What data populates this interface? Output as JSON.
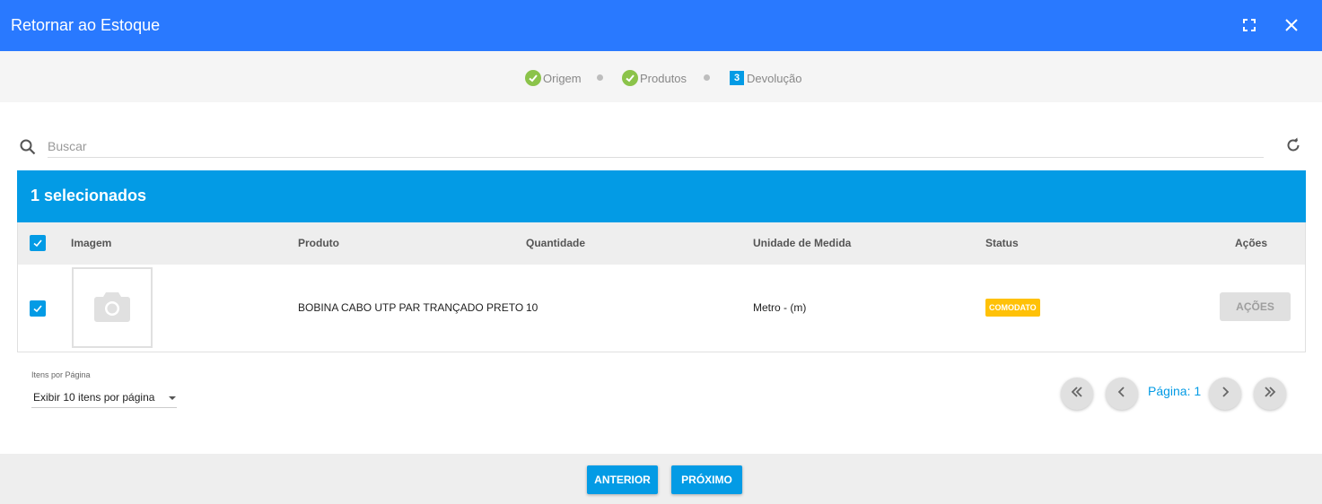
{
  "dialog": {
    "title": "Retornar ao Estoque"
  },
  "icons": {
    "fullscreen": "fullscreen-icon",
    "close": "close-icon",
    "search": "search-icon",
    "refresh": "refresh-icon",
    "camera": "camera-icon"
  },
  "stepper": {
    "steps": [
      {
        "label": "Origem",
        "state": "done"
      },
      {
        "label": "Produtos",
        "state": "done"
      },
      {
        "label": "Devolução",
        "state": "active",
        "number": "3"
      }
    ]
  },
  "search": {
    "placeholder": "Buscar",
    "value": ""
  },
  "selection": {
    "label": "1 selecionados"
  },
  "table": {
    "columns": [
      "Imagem",
      "Produto",
      "Quantidade",
      "Unidade de Medida",
      "Status",
      "Ações"
    ],
    "rows": [
      {
        "checked": true,
        "produto": "BOBINA CABO UTP PAR TRANÇADO PRETO",
        "quantidade": "10",
        "unidade": "Metro - (m)",
        "status": "COMODATO",
        "acoes": "AÇÕES"
      }
    ]
  },
  "pagination": {
    "per_page_label": "Itens por Página",
    "per_page_value": "Exibir 10 itens por página",
    "page_label": "Página: 1"
  },
  "footer": {
    "prev_label": "ANTERIOR",
    "next_label": "PRÓXIMO"
  },
  "colors": {
    "header": "#2979ff",
    "accent": "#039be5",
    "done": "#8bc34a",
    "status_comodato": "#ffc107"
  }
}
